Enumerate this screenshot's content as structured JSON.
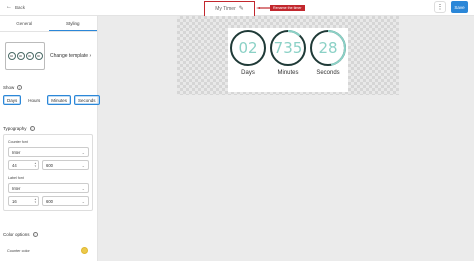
{
  "header": {
    "back_label": "Back",
    "timer_name": "My Timer",
    "rename_hint": "Rename the timer",
    "save_label": "Save"
  },
  "sidebar": {
    "tabs": [
      {
        "label": "General",
        "active": false
      },
      {
        "label": "Styling",
        "active": true
      }
    ],
    "template": {
      "change_label": "Change template",
      "thumb_values": [
        "02",
        "00",
        "00",
        "00"
      ]
    },
    "show": {
      "label": "Show",
      "options": [
        {
          "label": "Days",
          "selected": true
        },
        {
          "label": "Hours",
          "selected": false
        },
        {
          "label": "Minutes",
          "selected": true
        },
        {
          "label": "Seconds",
          "selected": true
        }
      ]
    },
    "typography": {
      "label": "Typography",
      "counter_font": {
        "label": "Counter font",
        "family": "Inter",
        "size": "44",
        "weight": "600"
      },
      "label_font": {
        "label": "Label font",
        "family": "Inter",
        "size": "16",
        "weight": "600"
      }
    },
    "color_options": {
      "label": "Color options",
      "counter_color_label": "Counter color",
      "counter_color": "#ecc94b"
    }
  },
  "preview": {
    "ring_color": "#1f3a37",
    "ring_progress_color": "#8bd1c6",
    "number_color": "#8bd1c6",
    "units": [
      {
        "value": "02",
        "label": "Days",
        "progress": 0.0
      },
      {
        "value": "735",
        "label": "Minutes",
        "progress": 0.12
      },
      {
        "value": "28",
        "label": "Seconds",
        "progress": 0.47
      }
    ]
  },
  "colors": {
    "accent": "#2b87d8",
    "annotation": "#c2272d"
  }
}
